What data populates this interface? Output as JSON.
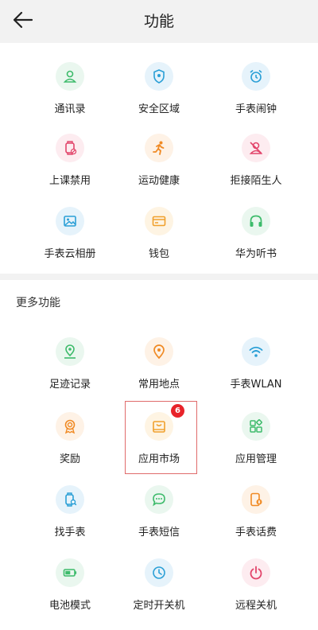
{
  "header": {
    "title": "功能"
  },
  "top_section": {
    "items": [
      {
        "label": "通讯录",
        "icon": "contacts-icon",
        "color": "#3dbb6b"
      },
      {
        "label": "安全区域",
        "icon": "shield-location-icon",
        "color": "#2a9fd6"
      },
      {
        "label": "手表闹钟",
        "icon": "alarm-clock-icon",
        "color": "#2a9fd6"
      },
      {
        "label": "上课禁用",
        "icon": "watch-disabled-icon",
        "color": "#e2456b"
      },
      {
        "label": "运动健康",
        "icon": "running-icon",
        "color": "#f08a24"
      },
      {
        "label": "拒接陌生人",
        "icon": "block-person-icon",
        "color": "#e2456b"
      },
      {
        "label": "手表云相册",
        "icon": "photo-album-icon",
        "color": "#2a9fd6"
      },
      {
        "label": "钱包",
        "icon": "wallet-icon",
        "color": "#f0a02c"
      },
      {
        "label": "华为听书",
        "icon": "headphones-icon",
        "color": "#3dbb6b"
      }
    ]
  },
  "more_section": {
    "title": "更多功能",
    "items": [
      {
        "label": "足迹记录",
        "icon": "footprint-location-icon",
        "color": "#3dbb6b"
      },
      {
        "label": "常用地点",
        "icon": "map-pin-icon",
        "color": "#f08a24"
      },
      {
        "label": "手表WLAN",
        "icon": "wifi-icon",
        "color": "#2a9fd6"
      },
      {
        "label": "奖励",
        "icon": "medal-icon",
        "color": "#f08a24"
      },
      {
        "label": "应用市场",
        "icon": "app-store-bag-icon",
        "color": "#f0a02c",
        "badge": "6"
      },
      {
        "label": "应用管理",
        "icon": "app-grid-icon",
        "color": "#3dbb6b"
      },
      {
        "label": "找手表",
        "icon": "find-watch-icon",
        "color": "#2a9fd6"
      },
      {
        "label": "手表短信",
        "icon": "message-icon",
        "color": "#3dbb6b"
      },
      {
        "label": "手表话费",
        "icon": "phone-bill-icon",
        "color": "#f08a24"
      },
      {
        "label": "电池模式",
        "icon": "battery-icon",
        "color": "#3dbb6b"
      },
      {
        "label": "定时开关机",
        "icon": "timer-icon",
        "color": "#2a9fd6"
      },
      {
        "label": "远程关机",
        "icon": "power-icon",
        "color": "#e2456b"
      }
    ]
  }
}
